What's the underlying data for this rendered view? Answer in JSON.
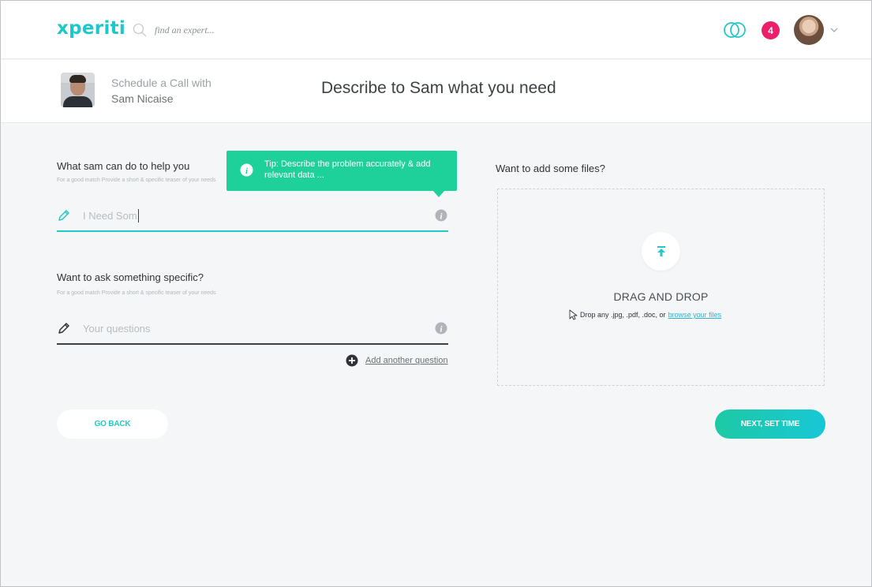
{
  "nav": {
    "logo": "xperiti",
    "search_placeholder": "find an expert...",
    "notification_count": "4"
  },
  "subheader": {
    "schedule_label": "Schedule a Call with",
    "expert_name": "Sam Nicaise",
    "title": "Describe to Sam what you need"
  },
  "help_section": {
    "label": "What sam can do to help you",
    "hint": "For a good match Provide a short & specific teaser of your needs",
    "value": "I Need Som"
  },
  "tooltip": {
    "text": "Tip: Describe the problem accurately & add relevant data ..."
  },
  "question_section": {
    "label": "Want to ask something specific?",
    "hint": "For a good match Provide a short & specific teaser of your needs",
    "placeholder": "Your questions",
    "add_label": "Add another question"
  },
  "files_section": {
    "label": "Want to add some files?",
    "drag_title": "DRAG AND DROP",
    "drop_text": "Drop any .jpg, .pdf, .doc, or",
    "browse_label": "browse your files"
  },
  "buttons": {
    "back": "GO BACK",
    "next": "NEXT, SET TIME"
  },
  "colors": {
    "accent": "#25c7c7",
    "tooltip": "#1ed19b",
    "badge": "#ec1f6b"
  }
}
